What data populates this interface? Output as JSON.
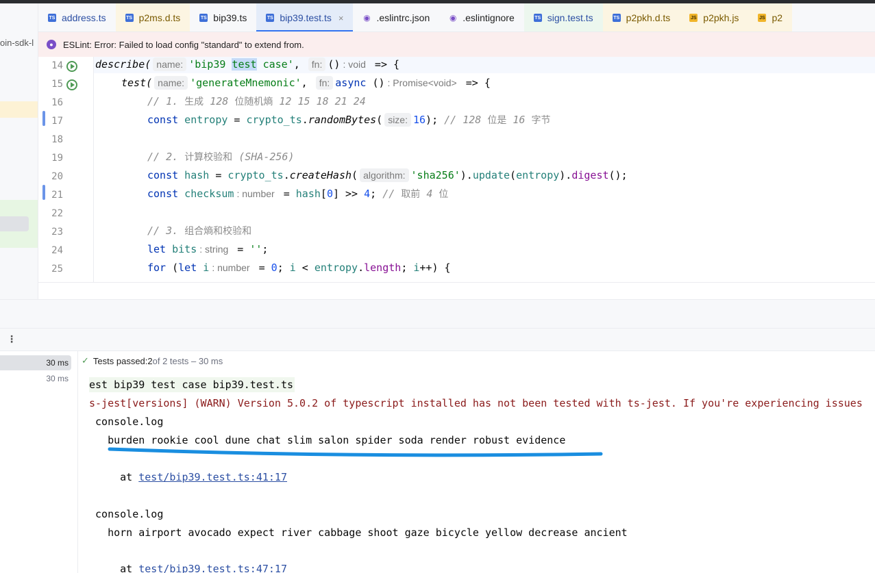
{
  "project_label": "oin-sdk-l",
  "tabs": [
    {
      "label": "address.ts",
      "icon": "ts-file-icon",
      "color": "blue",
      "bg": ""
    },
    {
      "label": "p2ms.d.ts",
      "icon": "ts-file-icon",
      "color": "olive",
      "bg": "yellowbg"
    },
    {
      "label": "bip39.ts",
      "icon": "ts-file-icon",
      "color": "",
      "bg": ""
    },
    {
      "label": "bip39.test.ts",
      "icon": "ts-test-file-icon",
      "color": "blue",
      "bg": "active"
    },
    {
      "label": ".eslintrc.json",
      "icon": "eslint-config-icon",
      "color": "",
      "bg": ""
    },
    {
      "label": ".eslintignore",
      "icon": "eslint-config-icon",
      "color": "",
      "bg": ""
    },
    {
      "label": "sign.test.ts",
      "icon": "ts-test-file-icon",
      "color": "blue",
      "bg": "greenbg"
    },
    {
      "label": "p2pkh.d.ts",
      "icon": "ts-file-icon",
      "color": "olive",
      "bg": "yellowbg"
    },
    {
      "label": "p2pkh.js",
      "icon": "js-file-icon",
      "color": "olive",
      "bg": "yellowbg"
    },
    {
      "label": "p2",
      "icon": "js-file-icon",
      "color": "olive",
      "bg": "yellowbg"
    }
  ],
  "banner": {
    "text": "ESLint: Error: Failed to load config \"standard\" to extend from."
  },
  "editor": {
    "line_numbers": [
      "14",
      "15",
      "16",
      "17",
      "18",
      "19",
      "20",
      "21",
      "22",
      "23",
      "24",
      "25"
    ],
    "l14": {
      "a": "describe(",
      "hint1": "name:",
      "s1": "'bip39 ",
      "hl": "test",
      "s2": " case'",
      "c1": ", ",
      "hint2": "fn:",
      "p": "()",
      "t": ": void",
      "arrow": " => {"
    },
    "l15": {
      "a": "test(",
      "hint1": "name:",
      "s1": "'generateMnemonic'",
      "c1": ", ",
      "hint2": "fn:",
      "kw": "async",
      "p": " ()",
      "t": ": Promise<void>",
      "arrow": " => {"
    },
    "l16": {
      "cmt": "// 1. ",
      "cmtc": "生成",
      "cmt2": " 128 ",
      "cmtc2": "位随机熵",
      "cmt3": " 12 15 18 21 24"
    },
    "l17": {
      "kw": "const",
      "v": " entropy",
      "eq": " = ",
      "obj": "crypto_ts",
      "dot": ".",
      "fn": "randomBytes",
      "op": "(",
      "hint": "size:",
      "num": "16",
      "cl": ");",
      "cmt": " // 128 ",
      "cmtc": "位是",
      "cmt2": " 16 ",
      "cmtc2": "字节"
    },
    "l19": {
      "cmt": "// 2. ",
      "cmtc": "计算校验和",
      "cmt2": " (SHA-256)"
    },
    "l20": {
      "kw": "const",
      "v": " hash",
      "eq": " = ",
      "obj": "crypto_ts",
      "dot": ".",
      "fn": "createHash",
      "op": "(",
      "hint": "algorithm:",
      "str": "'sha256'",
      "cl": ").",
      "m1": "update",
      "o2": "(",
      "arg": "entropy",
      "c2": ").",
      "m2": "digest",
      "end": "();"
    },
    "l21": {
      "kw": "const",
      "v": " checksum",
      "t": ": number",
      "eq": " = ",
      "v2": "hash",
      "b1": "[",
      "num": "0",
      "b2": "] >> ",
      "num2": "4",
      "semi": ";",
      "cmt": " // ",
      "cmtc": "取前",
      "cmt2": " 4 ",
      "cmtc2": "位"
    },
    "l23": {
      "cmt": "// 3. ",
      "cmtc": "组合熵和校验和"
    },
    "l24": {
      "kw": "let",
      "v": " bits",
      "t": ": string",
      "eq": " = ",
      "str": "''",
      "semi": ";"
    },
    "l25": {
      "kw": "for",
      "p1": " (",
      "kw2": "let",
      "v": " i",
      "t": ": number",
      "eq": " = ",
      "num": "0",
      "r1": "; ",
      "v2": "i",
      "r2": " < ",
      "v3": "entropy",
      "dot": ".",
      "prop": "length",
      "r3": "; ",
      "v4": "i",
      "r4": "++) {"
    }
  },
  "tests_tree": {
    "rows": [
      "30 ms",
      "30 ms"
    ]
  },
  "console": {
    "status_prefix": "Tests passed: ",
    "status_count": "2",
    "status_suffix": " of 2 tests – 30 ms",
    "lines": {
      "header": "est bip39 test case bip39.test.ts",
      "warn": "s-jest[versions] (WARN) Version 5.0.2 of typescript installed has not been tested with ts-jest. If you're experiencing issues",
      "log1": " console.log",
      "mnemonic1": "   burden rookie cool dune chat slim salon spider soda render robust evidence",
      "at1_prefix": "     at ",
      "at1_link": "test/bip39.test.ts:41:17",
      "log2": " console.log",
      "mnemonic2": "   horn airport avocado expect river cabbage shoot gaze bicycle yellow decrease ancient",
      "at2_prefix": "     at ",
      "at2_link": "test/bip39.test.ts:47:17"
    }
  },
  "colors": {
    "accent": "#3574f0",
    "underline": "#1a8ee0",
    "pass": "#4f9a55"
  }
}
